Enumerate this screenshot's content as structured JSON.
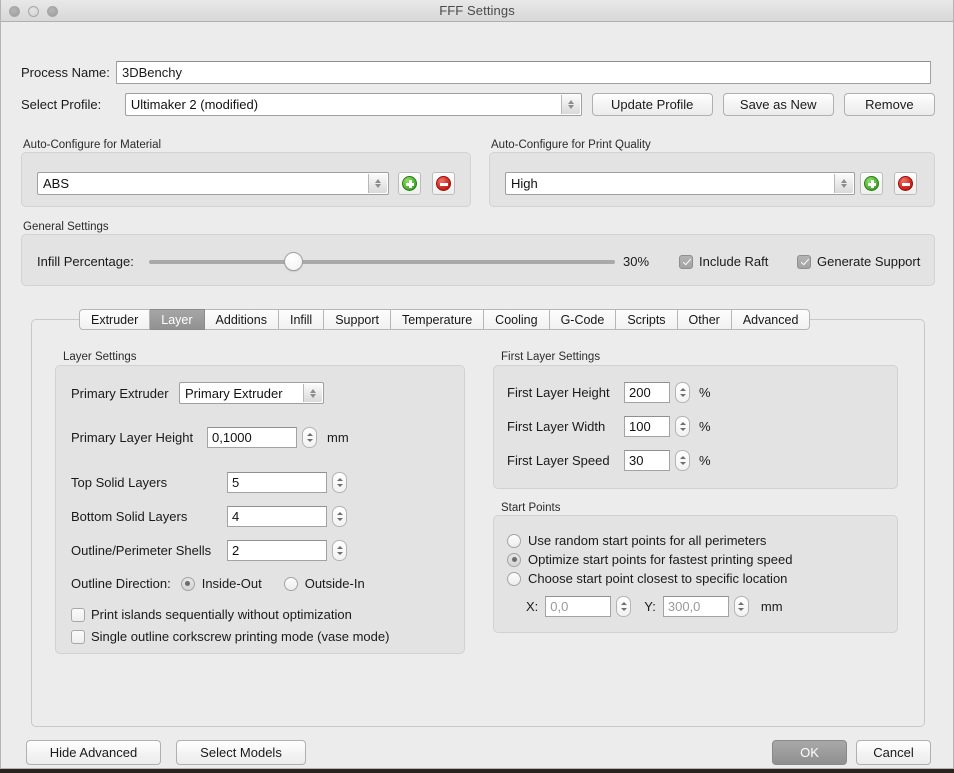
{
  "window": {
    "title": "FFF Settings",
    "traffic_lights": [
      "close-button",
      "minimize-button",
      "zoom-button"
    ]
  },
  "top": {
    "process_name_label": "Process Name:",
    "process_name_value": "3DBenchy",
    "select_profile_label": "Select Profile:",
    "select_profile_value": "Ultimaker 2 (modified)",
    "update_profile_label": "Update Profile",
    "save_as_new_label": "Save as New",
    "remove_label": "Remove"
  },
  "material_group": {
    "title": "Auto-Configure for Material",
    "value": "ABS",
    "add_label": "+",
    "remove_label": "−"
  },
  "quality_group": {
    "title": "Auto-Configure for Print Quality",
    "value": "High",
    "add_label": "+",
    "remove_label": "−"
  },
  "general_group": {
    "title": "General Settings",
    "infill_label": "Infill Percentage:",
    "infill_value": "30%",
    "infill_percent": 30,
    "include_raft_label": "Include Raft",
    "include_raft_checked": true,
    "generate_support_label": "Generate Support",
    "generate_support_checked": true
  },
  "tabs": [
    {
      "label": "Extruder",
      "active": false
    },
    {
      "label": "Layer",
      "active": true
    },
    {
      "label": "Additions",
      "active": false
    },
    {
      "label": "Infill",
      "active": false
    },
    {
      "label": "Support",
      "active": false
    },
    {
      "label": "Temperature",
      "active": false
    },
    {
      "label": "Cooling",
      "active": false
    },
    {
      "label": "G-Code",
      "active": false
    },
    {
      "label": "Scripts",
      "active": false
    },
    {
      "label": "Other",
      "active": false
    },
    {
      "label": "Advanced",
      "active": false
    }
  ],
  "layer_settings": {
    "title": "Layer Settings",
    "primary_extruder_label": "Primary Extruder",
    "primary_extruder_value": "Primary Extruder",
    "primary_layer_height_label": "Primary Layer Height",
    "primary_layer_height_value": "0,1000",
    "primary_layer_height_unit": "mm",
    "top_solid_layers_label": "Top Solid Layers",
    "top_solid_layers_value": "5",
    "bottom_solid_layers_label": "Bottom Solid Layers",
    "bottom_solid_layers_value": "4",
    "outline_shells_label": "Outline/Perimeter Shells",
    "outline_shells_value": "2",
    "outline_direction_label": "Outline Direction:",
    "outline_inside_out_label": "Inside-Out",
    "outline_outside_in_label": "Outside-In",
    "outline_direction_selected": "Inside-Out",
    "print_islands_label": "Print islands sequentially without optimization",
    "print_islands_checked": false,
    "vase_mode_label": "Single outline corkscrew printing mode (vase mode)",
    "vase_mode_checked": false
  },
  "first_layer_settings": {
    "title": "First Layer Settings",
    "height_label": "First Layer Height",
    "height_value": "200",
    "height_unit": "%",
    "width_label": "First Layer Width",
    "width_value": "100",
    "width_unit": "%",
    "speed_label": "First Layer Speed",
    "speed_value": "30",
    "speed_unit": "%"
  },
  "start_points": {
    "title": "Start Points",
    "random_label": "Use random start points for all perimeters",
    "optimize_label": "Optimize start points for fastest printing speed",
    "specific_label": "Choose start point closest to specific location",
    "selected": "Optimize start points for fastest printing speed",
    "x_label": "X:",
    "x_value": "0,0",
    "y_label": "Y:",
    "y_value": "300,0",
    "unit": "mm"
  },
  "footer": {
    "hide_advanced_label": "Hide Advanced",
    "select_models_label": "Select Models",
    "ok_label": "OK",
    "cancel_label": "Cancel"
  },
  "colors": {
    "window_bg": "#ececec",
    "group_bg": "#e3e3e3",
    "accent_add": "#53b833",
    "accent_remove": "#d62b22",
    "tab_active_bg": "#919191",
    "ok_disabled_bg": "#8f8f8f"
  }
}
